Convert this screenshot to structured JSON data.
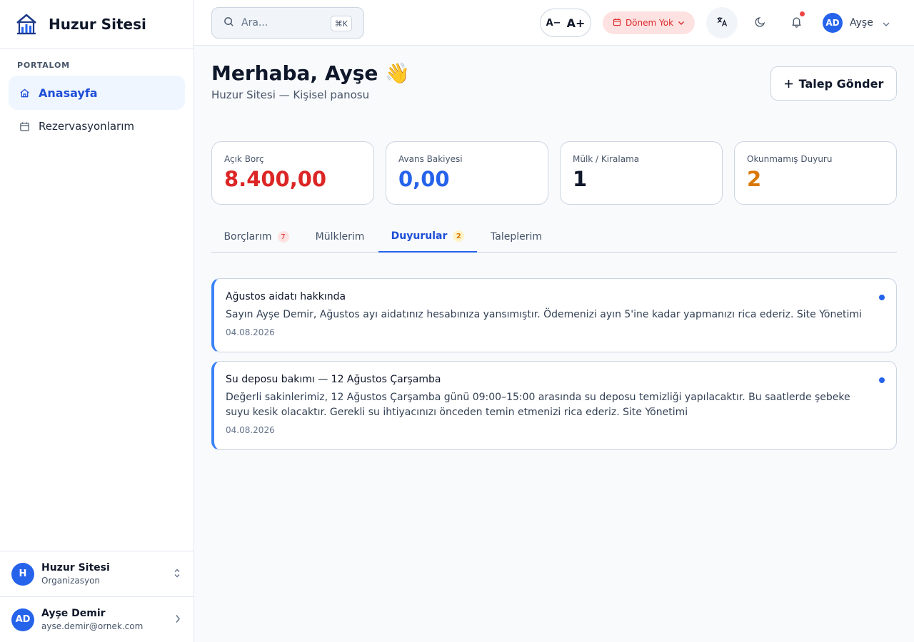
{
  "app": {
    "name": "Huzur Sitesi"
  },
  "sidebar": {
    "section_label": "PORTALOM",
    "items": [
      {
        "label": "Anasayfa",
        "icon": "home-icon",
        "active": true
      },
      {
        "label": "Rezervasyonlarım",
        "icon": "calendar-icon",
        "active": false
      }
    ],
    "organization": {
      "initial": "H",
      "name": "Huzur Sitesi",
      "type": "Organizasyon"
    },
    "user": {
      "initials": "AD",
      "name": "Ayşe Demir",
      "email": "ayse.demir@ornek.com"
    }
  },
  "topbar": {
    "search": {
      "placeholder": "Ara...",
      "shortcut": "⌘K"
    },
    "font_size": {
      "decrease": "A−",
      "increase": "A+"
    },
    "period": {
      "label": "Dönem Yok",
      "color": "#dc2626"
    },
    "profile": {
      "initials": "AD",
      "name": "Ayşe"
    }
  },
  "main": {
    "greeting": "Merhaba, Ayşe 👋",
    "subtitle": "Huzur Sitesi — Kişisel panosu",
    "request_button": "Talep Gönder",
    "stats": [
      {
        "label": "Açık Borç",
        "value": "8.400,00",
        "color": "#dc2626"
      },
      {
        "label": "Avans Bakiyesi",
        "value": "0,00",
        "color": "#2563eb"
      },
      {
        "label": "Mülk / Kiralama",
        "value": "1",
        "color": "#0f172a"
      },
      {
        "label": "Okunmamış Duyuru",
        "value": "2",
        "color": "#d97706"
      }
    ],
    "tabs": [
      {
        "label": "Borçlarım",
        "badge": "7",
        "active": false
      },
      {
        "label": "Mülklerim",
        "badge": "",
        "active": false
      },
      {
        "label": "Duyurular",
        "badge": "2",
        "active": true
      },
      {
        "label": "Taleplerim",
        "badge": "",
        "active": false
      }
    ],
    "announcements": [
      {
        "title": "Ağustos aidatı hakkında",
        "body": "Sayın Ayşe Demir, Ağustos ayı aidatınız hesabınıza yansımıştır. Ödemenizi ayın 5'ine kadar yapmanızı rica ederiz. Site Yönetimi",
        "date": "04.08.2026",
        "unread": true
      },
      {
        "title": "Su deposu bakımı — 12 Ağustos Çarşamba",
        "body": "Değerli sakinlerimiz, 12 Ağustos Çarşamba günü 09:00–15:00 arasında su deposu temizliği yapılacaktır. Bu saatlerde şebeke suyu kesik olacaktır. Gerekli su ihtiyacınızı önceden temin etmenizi rica ederiz. Site Yönetimi",
        "date": "04.08.2026",
        "unread": true
      }
    ]
  },
  "colors": {
    "accent": "#2563eb",
    "danger": "#dc2626",
    "warning": "#d97706"
  }
}
